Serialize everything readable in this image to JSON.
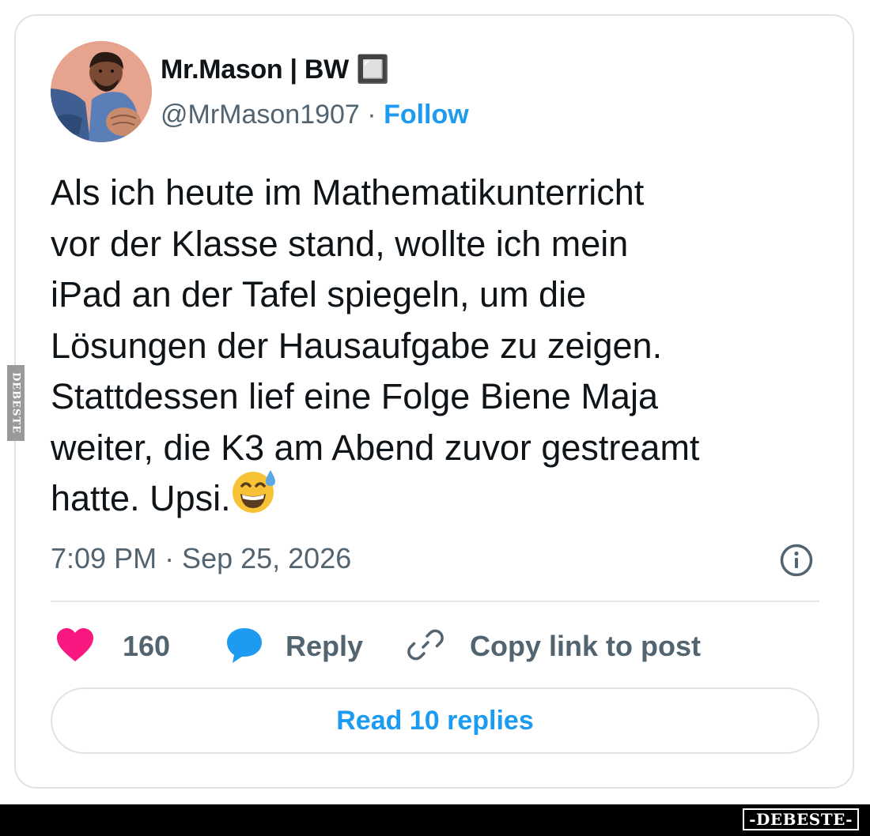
{
  "author": {
    "display_name": "Mr.Mason | BW 🔲",
    "handle": "@MrMason1907",
    "separator": " · ",
    "follow_label": "Follow"
  },
  "tweet": {
    "text": "Als ich heute im Mathematikunterricht\nvor der Klasse stand, wollte ich mein\niPad an der Tafel spiegeln, um die\nLösungen der Hausaufgabe zu zeigen.\nStattdessen lief eine Folge Biene Maja\nweiter, die K3 am Abend zuvor gestreamt\nhatte. Upsi.",
    "emoji": "grinning-face-with-sweat",
    "timestamp": "7:09 PM · Sep 25, 2026"
  },
  "actions": {
    "like_count": "160",
    "reply_label": "Reply",
    "copy_link_label": "Copy link to post"
  },
  "read_replies_label": "Read 10 replies",
  "watermark": {
    "side": "DEBESTE",
    "bottom": "-DEBESTE-"
  },
  "colors": {
    "accent": "#1d9bf0",
    "heart": "#f91880",
    "secondary_text": "#536471",
    "primary_text": "#0f1419",
    "border": "#dfe3e6"
  }
}
